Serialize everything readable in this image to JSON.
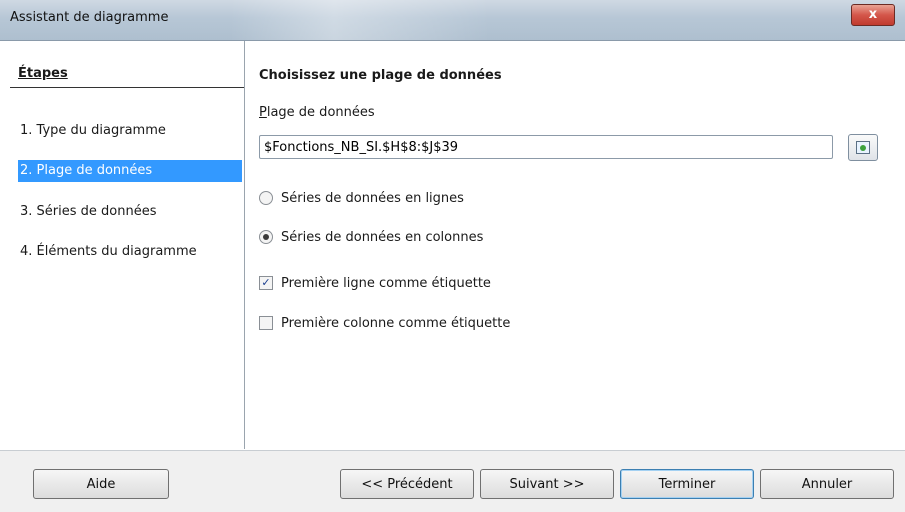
{
  "window": {
    "title": "Assistant de diagramme",
    "close_label": "x"
  },
  "steps": {
    "heading": "Étapes",
    "items": [
      {
        "label": "1. Type du diagramme",
        "active": false
      },
      {
        "label": "2. Plage de données",
        "active": true
      },
      {
        "label": "3. Séries de données",
        "active": false
      },
      {
        "label": "4. Éléments du diagramme",
        "active": false
      }
    ]
  },
  "main": {
    "section_title": "Choisissez une plage de données",
    "range_label": "Plage de données",
    "range_value": "$Fonctions_NB_SI.$H$8:$J$39",
    "radio_rows": "Séries de données en lignes",
    "radio_columns": "Séries de données en colonnes",
    "selected_series": "columns",
    "check_first_row": "Première ligne comme étiquette",
    "check_first_row_checked": true,
    "check_first_col": "Première colonne comme étiquette",
    "check_first_col_checked": false
  },
  "buttons": {
    "help": "Aide",
    "previous": "<< Précédent",
    "next": "Suivant >>",
    "finish": "Terminer",
    "cancel": "Annuler"
  },
  "icons": {
    "close": "close-icon",
    "shrink": "shrink-dialog-icon"
  }
}
